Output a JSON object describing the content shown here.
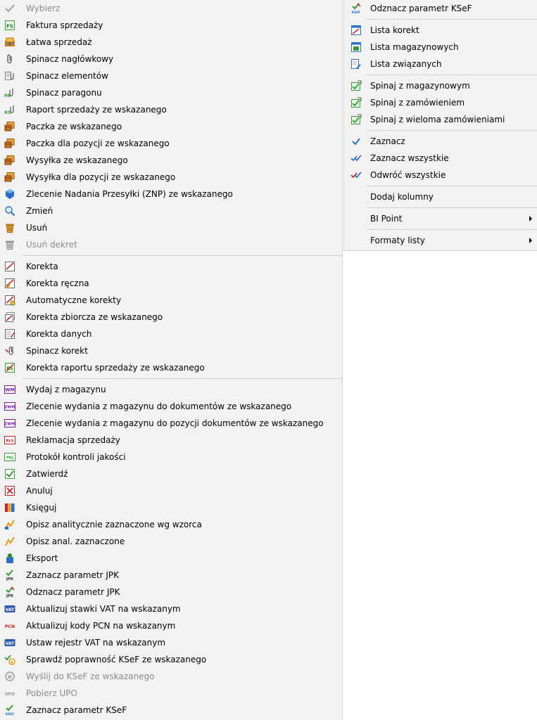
{
  "left_menu": {
    "groups": [
      [
        {
          "label": "Wybierz",
          "icon": "checkmark-icon",
          "disabled": true
        },
        {
          "label": "Faktura sprzedaży",
          "icon": "fs-document-icon"
        },
        {
          "label": "Łatwa sprzedaż",
          "icon": "easy-sale-icon"
        },
        {
          "label": "Spinacz nagłówkowy",
          "icon": "paperclip-icon"
        },
        {
          "label": "Spinacz elementów",
          "icon": "paperclip-elements-icon"
        },
        {
          "label": "Spinacz paragonu",
          "icon": "paperclip-receipt-icon"
        },
        {
          "label": "Raport sprzedaży ze wskazanego",
          "icon": "sales-report-clip-icon"
        },
        {
          "label": "Paczka ze wskazanego",
          "icon": "package-icon"
        },
        {
          "label": "Paczka dla pozycji ze wskazanego",
          "icon": "package-icon"
        },
        {
          "label": "Wysyłka ze wskazanego",
          "icon": "package-icon"
        },
        {
          "label": "Wysyłka dla pozycji ze wskazanego",
          "icon": "package-icon"
        },
        {
          "label": "Zlecenie Nadania Przesyłki (ZNP) ze wskazanego",
          "icon": "shipping-cube-icon"
        },
        {
          "label": "Zmień",
          "icon": "magnifier-icon"
        },
        {
          "label": "Usuń",
          "icon": "trash-icon"
        },
        {
          "label": "Usuń dekret",
          "icon": "trash-gray-icon",
          "disabled": true
        }
      ],
      [
        {
          "label": "Korekta",
          "icon": "correction-icon"
        },
        {
          "label": "Korekta ręczna",
          "icon": "manual-correction-icon"
        },
        {
          "label": "Automatyczne korekty",
          "icon": "auto-correction-icon"
        },
        {
          "label": "Korekta zbiorcza ze wskazanego",
          "icon": "collective-correction-icon"
        },
        {
          "label": "Korekta danych",
          "icon": "data-correction-icon"
        },
        {
          "label": "Spinacz korekt",
          "icon": "correction-clip-icon"
        },
        {
          "label": "Korekta raportu sprzedaży ze wskazanego",
          "icon": "report-correction-icon"
        }
      ],
      [
        {
          "label": "Wydaj z magazynu",
          "icon": "wm-icon",
          "badge": "WM"
        },
        {
          "label": "Zlecenie wydania z magazynu do dokumentów ze wskazanego",
          "icon": "zwm-icon",
          "badge": "ZWM"
        },
        {
          "label": "Zlecenie wydania z magazynu do pozycji dokumentów ze wskazanego",
          "icon": "zwm-icon",
          "badge": "ZWM"
        },
        {
          "label": "Reklamacja sprzedaży",
          "icon": "rls-icon",
          "badge": "RLS"
        },
        {
          "label": "Protokół kontroli jakości",
          "icon": "pkj-icon",
          "badge": "PKJ"
        },
        {
          "label": "Zatwierdź",
          "icon": "approve-icon"
        },
        {
          "label": "Anuluj",
          "icon": "cancel-icon"
        },
        {
          "label": "Księguj",
          "icon": "books-icon"
        },
        {
          "label": "Opisz analitycznie zaznaczone wg wzorca",
          "icon": "analytic-pattern-icon"
        },
        {
          "label": "Opisz anal. zaznaczone",
          "icon": "analytic-icon"
        },
        {
          "label": "Eksport",
          "icon": "export-icon"
        },
        {
          "label": "Zaznacz parametr JPK",
          "icon": "jpk-check-icon",
          "badge": "JPK"
        },
        {
          "label": "Odznacz parametr JPK",
          "icon": "jpk-uncheck-icon",
          "badge": "JPK"
        },
        {
          "label": "Aktualizuj stawki VAT na wskazanym",
          "icon": "vat-icon",
          "badge": "VAT"
        },
        {
          "label": "Aktualizuj kody PCN na wskazanym",
          "icon": "pcn-icon",
          "badge": "PCN"
        },
        {
          "label": "Ustaw rejestr VAT na wskazanym",
          "icon": "vat-icon",
          "badge": "VAT"
        },
        {
          "label": "Sprawdź poprawność KSeF ze wskazanego",
          "icon": "ksef-verify-icon"
        },
        {
          "label": "Wyślij do KSeF ze wskazanego",
          "icon": "ksef-send-icon",
          "disabled": true
        },
        {
          "label": "Pobierz UPO",
          "icon": "upo-icon",
          "badge": "UPO",
          "disabled": true
        },
        {
          "label": "Zaznacz parametr KSeF",
          "icon": "ksef-check-icon",
          "badge": "KSEF"
        }
      ]
    ]
  },
  "right_menu": {
    "groups": [
      [
        {
          "label": "Odznacz parametr KSeF",
          "icon": "ksef-uncheck-icon",
          "badge": "KSEF"
        }
      ],
      [
        {
          "label": "Lista korekt",
          "icon": "list-corrections-icon"
        },
        {
          "label": "Lista magazynowych",
          "icon": "list-warehouse-icon"
        },
        {
          "label": "Lista związanych",
          "icon": "list-related-icon"
        }
      ],
      [
        {
          "label": "Spinaj z magazynowym",
          "icon": "link-warehouse-icon"
        },
        {
          "label": "Spinaj z zamówieniem",
          "icon": "link-order-icon"
        },
        {
          "label": "Spinaj z wieloma zamówieniami",
          "icon": "link-orders-icon"
        }
      ],
      [
        {
          "label": "Zaznacz",
          "icon": "select-check-icon"
        },
        {
          "label": "Zaznacz wszystkie",
          "icon": "select-all-icon"
        },
        {
          "label": "Odwróć wszystkie",
          "icon": "invert-selection-icon"
        }
      ],
      [
        {
          "label": "Dodaj kolumny",
          "icon": ""
        }
      ],
      [
        {
          "label": "BI Point",
          "icon": "",
          "submenu": true
        }
      ],
      [
        {
          "label": "Formaty listy",
          "icon": "",
          "submenu": true
        }
      ]
    ]
  },
  "colors": {
    "menu_bg": "#f2f2f2",
    "separator": "#d0d0d0",
    "disabled_text": "#8c8c8c",
    "check_green": "#3a9a3a",
    "red": "#d02020",
    "blue": "#2a6fc9",
    "orange": "#e89a1a"
  }
}
